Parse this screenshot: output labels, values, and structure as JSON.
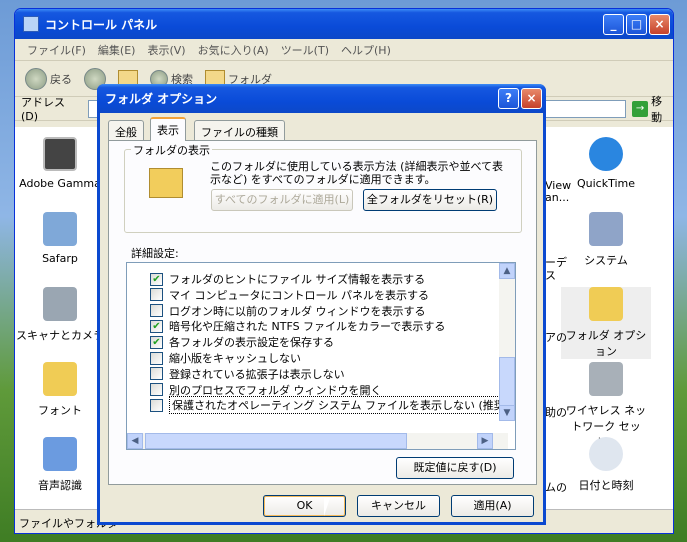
{
  "window": {
    "title": "コントロール パネル",
    "min": "_",
    "max": "□",
    "close": "×"
  },
  "menu": [
    "ファイル(F)",
    "編集(E)",
    "表示(V)",
    "お気に入り(A)",
    "ツール(T)",
    "ヘルプ(H)"
  ],
  "toolbar": {
    "back": "戻る",
    "search": "検索",
    "folders": "フォルダ"
  },
  "address": {
    "label": "アドレス(D)",
    "go": "移動"
  },
  "icons": [
    {
      "label": "Adobe Gamma",
      "icon": "monitor-icon"
    },
    {
      "label": "Safarp",
      "icon": "safarp-icon"
    },
    {
      "label": "スキャナとカメラ",
      "icon": "scanner-camera-icon"
    },
    {
      "label": "フォント",
      "icon": "font-folder-icon"
    },
    {
      "label": "音声認識",
      "icon": "speech-icon"
    },
    {
      "label": "QuickTime",
      "icon": "quicktime-icon"
    },
    {
      "label": "システム",
      "icon": "system-icon"
    },
    {
      "label": "フォルダ オプション",
      "icon": "folder-options-icon"
    },
    {
      "label": "ワイヤレス ネットワーク セット...",
      "icon": "wireless-icon"
    },
    {
      "label": "日付と時刻",
      "icon": "clock-icon"
    }
  ],
  "partial": [
    "View",
    "an...",
    "ーデ",
    "ス",
    "アの",
    "助の",
    "ムの"
  ],
  "status": "ファイルやフォルダ",
  "dialog": {
    "title": "フォルダ オプション",
    "help": "?",
    "close": "×",
    "tabs": [
      "全般",
      "表示",
      "ファイルの種類"
    ],
    "group_title": "フォルダの表示",
    "group_text": "このフォルダに使用している表示方法 (詳細表示や並べて表示など) をすべてのフォルダに適用できます。",
    "apply_all": "すべてのフォルダに適用(L)",
    "reset_all": "全フォルダをリセット(R)",
    "advanced": "詳細設定:",
    "settings": [
      {
        "label": "フォルダのヒントにファイル サイズ情報を表示する",
        "checked": true
      },
      {
        "label": "マイ コンピュータにコントロール パネルを表示する",
        "checked": false
      },
      {
        "label": "ログオン時に以前のフォルダ ウィンドウを表示する",
        "checked": false
      },
      {
        "label": "暗号化や圧縮された NTFS ファイルをカラーで表示する",
        "checked": true
      },
      {
        "label": "各フォルダの表示設定を保存する",
        "checked": true
      },
      {
        "label": "縮小版をキャッシュしない",
        "checked": false
      },
      {
        "label": "登録されている拡張子は表示しない",
        "checked": false
      },
      {
        "label": "別のプロセスでフォルダ ウィンドウを開く",
        "checked": false
      },
      {
        "label": "保護されたオペレーティング システム ファイルを表示しない (推奨)",
        "checked": false
      }
    ],
    "check_mark": "✔",
    "restore": "既定値に戻す(D)",
    "ok": "OK",
    "cancel": "キャンセル",
    "apply": "適用(A)"
  }
}
